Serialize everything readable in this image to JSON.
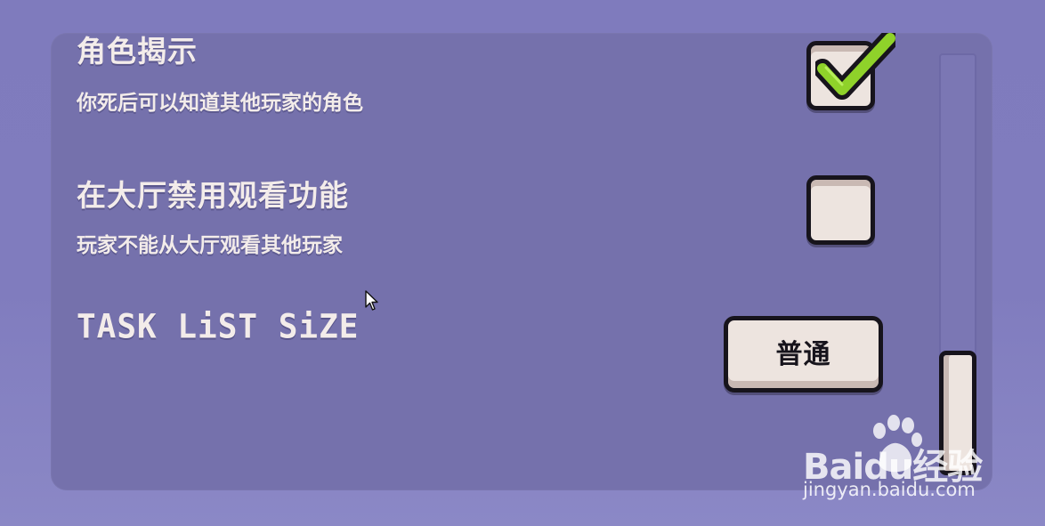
{
  "settings": {
    "role_reveal": {
      "title": "角色揭示",
      "description": "你死后可以知道其他玩家的角色",
      "checked": true
    },
    "disable_lobby_spectate": {
      "title": "在大厅禁用观看功能",
      "description": "玩家不能从大厅观看其他玩家",
      "checked": false
    },
    "task_list_size": {
      "title": "TASK LiST SiZE",
      "value": "普通"
    }
  },
  "scrollbar": {
    "position": "bottom"
  },
  "watermark": {
    "logo_text": "Baidu经验",
    "url": "jingyan.baidu.com"
  },
  "colors": {
    "background": "#807cbe",
    "panel": "#7571ac",
    "control_fill": "#ede4df",
    "control_border": "#17141c",
    "check_green": "#8fd22a",
    "text": "#f3ecea"
  },
  "icons": {
    "checkmark": "check-icon",
    "cursor": "mouse-pointer-icon",
    "watermark_logo": "baidu-paw-icon"
  }
}
